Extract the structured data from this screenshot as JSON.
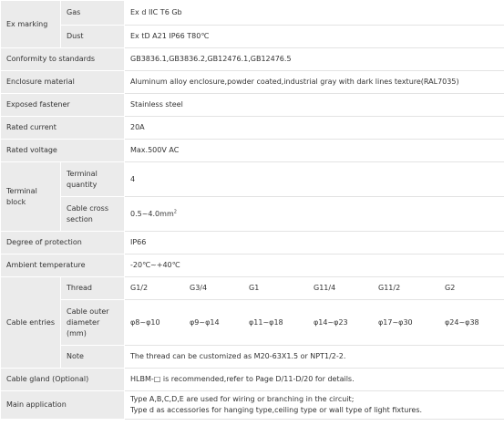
{
  "rows": {
    "ex_marking": {
      "label": "Ex marking",
      "gas_label": "Gas",
      "gas_value": "Ex d IIC T6 Gb",
      "dust_label": "Dust",
      "dust_value": "Ex tD A21 IP66 T80℃"
    },
    "conformity": {
      "label": "Conformity to standards",
      "value": "GB3836.1,GB3836.2,GB12476.1,GB12476.5"
    },
    "enclosure_material": {
      "label": "Enclosure material",
      "value": "Aluminum alloy enclosure,powder coated,industrial gray with dark lines texture(RAL7035)"
    },
    "exposed_fastener": {
      "label": "Exposed fastener",
      "value": "Stainless steel"
    },
    "rated_current": {
      "label": "Rated current",
      "value": "20A"
    },
    "rated_voltage": {
      "label": "Rated voltage",
      "value": "Max.500V  AC"
    },
    "terminal_block": {
      "label": "Terminal block",
      "quantity_label": "Terminal quantity",
      "quantity_value": "4",
      "cross_label": "Cable cross section",
      "cross_value": "0.5~4.0mm",
      "cross_sup": "2"
    },
    "protection": {
      "label": "Degree of protection",
      "value": "IP66"
    },
    "ambient": {
      "label": "Ambient temperature",
      "value": "-20℃~+40℃"
    },
    "cable_entries": {
      "label": "Cable entries",
      "thread_label": "Thread",
      "threads": [
        "G1/2",
        "G3/4",
        "G1",
        "G11/4",
        "G11/2",
        "G2"
      ],
      "diameter_label": "Cable outer diameter (mm)",
      "diameters": [
        "φ8~φ10",
        "φ9~φ14",
        "φ11~φ18",
        "φ14~φ23",
        "φ17~φ30",
        "φ24~φ38"
      ],
      "note_label": "Note",
      "note_value": "The thread can be customized as M20-63X1.5 or NPT1/2-2."
    },
    "cable_gland": {
      "label": "Cable gland (Optional)",
      "value": "HLBM-□ is recommended,refer to Page D/11-D/20 for details."
    },
    "main_application": {
      "label": "Main application",
      "line1": "Type A,B,C,D,E are used for wiring or branching in the circuit;",
      "line2": "Type d as accessories for hanging type,ceiling type or wall type of light fixtures."
    }
  }
}
